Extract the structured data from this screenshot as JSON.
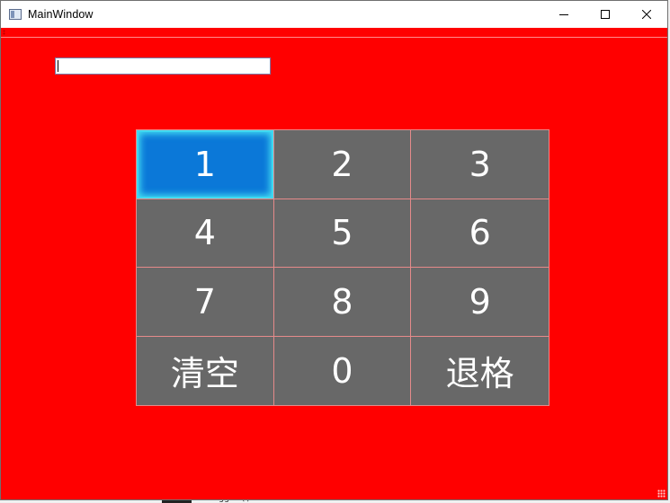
{
  "window": {
    "title": "MainWindow",
    "controls": {
      "minimize": "minimize-icon",
      "maximize": "maximize-icon",
      "close": "close-icon"
    },
    "background": "#ff0000"
  },
  "input": {
    "value": ""
  },
  "keypad": {
    "keys": [
      "1",
      "2",
      "3",
      "4",
      "5",
      "6",
      "7",
      "8",
      "9",
      "清空",
      "0",
      "退格"
    ],
    "focused_key": "1",
    "key_color": "#686868",
    "focus_color": "#0b78d8",
    "border_color": "#e58a8a"
  },
  "background_strip": {
    "find_label": "Find:",
    "text": "logger()"
  }
}
